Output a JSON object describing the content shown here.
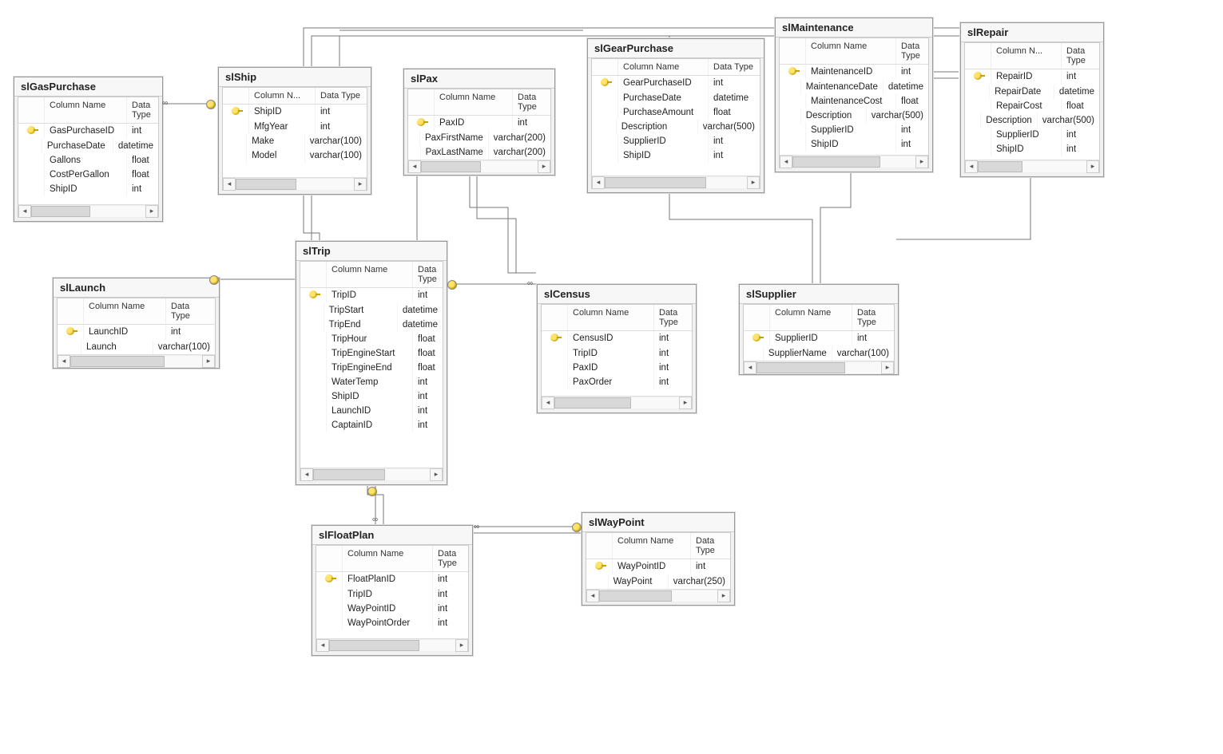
{
  "headers": {
    "col": "Column Name",
    "colShort": "Column N...",
    "type": "Data Type"
  },
  "tables": {
    "slGasPurchase": {
      "title": "slGasPurchase",
      "cols": [
        {
          "pk": true,
          "name": "GasPurchaseID",
          "type": "int"
        },
        {
          "pk": false,
          "name": "PurchaseDate",
          "type": "datetime"
        },
        {
          "pk": false,
          "name": "Gallons",
          "type": "float"
        },
        {
          "pk": false,
          "name": "CostPerGallon",
          "type": "float"
        },
        {
          "pk": false,
          "name": "ShipID",
          "type": "int"
        }
      ]
    },
    "slShip": {
      "title": "slShip",
      "cols": [
        {
          "pk": true,
          "name": "ShipID",
          "type": "int"
        },
        {
          "pk": false,
          "name": "MfgYear",
          "type": "int"
        },
        {
          "pk": false,
          "name": "Make",
          "type": "varchar(100)"
        },
        {
          "pk": false,
          "name": "Model",
          "type": "varchar(100)"
        }
      ]
    },
    "slPax": {
      "title": "slPax",
      "cols": [
        {
          "pk": true,
          "name": "PaxID",
          "type": "int"
        },
        {
          "pk": false,
          "name": "PaxFirstName",
          "type": "varchar(200)"
        },
        {
          "pk": false,
          "name": "PaxLastName",
          "type": "varchar(200)"
        }
      ]
    },
    "slGearPurchase": {
      "title": "slGearPurchase",
      "cols": [
        {
          "pk": true,
          "name": "GearPurchaseID",
          "type": "int"
        },
        {
          "pk": false,
          "name": "PurchaseDate",
          "type": "datetime"
        },
        {
          "pk": false,
          "name": "PurchaseAmount",
          "type": "float"
        },
        {
          "pk": false,
          "name": "Description",
          "type": "varchar(500)"
        },
        {
          "pk": false,
          "name": "SupplierID",
          "type": "int"
        },
        {
          "pk": false,
          "name": "ShipID",
          "type": "int"
        }
      ]
    },
    "slMaintenance": {
      "title": "slMaintenance",
      "cols": [
        {
          "pk": true,
          "name": "MaintenanceID",
          "type": "int"
        },
        {
          "pk": false,
          "name": "MaintenanceDate",
          "type": "datetime"
        },
        {
          "pk": false,
          "name": "MaintenanceCost",
          "type": "float"
        },
        {
          "pk": false,
          "name": "Description",
          "type": "varchar(500)"
        },
        {
          "pk": false,
          "name": "SupplierID",
          "type": "int"
        },
        {
          "pk": false,
          "name": "ShipID",
          "type": "int"
        }
      ]
    },
    "slRepair": {
      "title": "slRepair",
      "cols": [
        {
          "pk": true,
          "name": "RepairID",
          "type": "int"
        },
        {
          "pk": false,
          "name": "RepairDate",
          "type": "datetime"
        },
        {
          "pk": false,
          "name": "RepairCost",
          "type": "float"
        },
        {
          "pk": false,
          "name": "Description",
          "type": "varchar(500)"
        },
        {
          "pk": false,
          "name": "SupplierID",
          "type": "int"
        },
        {
          "pk": false,
          "name": "ShipID",
          "type": "int"
        }
      ]
    },
    "slLaunch": {
      "title": "slLaunch",
      "cols": [
        {
          "pk": true,
          "name": "LaunchID",
          "type": "int"
        },
        {
          "pk": false,
          "name": "Launch",
          "type": "varchar(100)"
        }
      ]
    },
    "slTrip": {
      "title": "slTrip",
      "cols": [
        {
          "pk": true,
          "name": "TripID",
          "type": "int"
        },
        {
          "pk": false,
          "name": "TripStart",
          "type": "datetime"
        },
        {
          "pk": false,
          "name": "TripEnd",
          "type": "datetime"
        },
        {
          "pk": false,
          "name": "TripHour",
          "type": "float"
        },
        {
          "pk": false,
          "name": "TripEngineStart",
          "type": "float"
        },
        {
          "pk": false,
          "name": "TripEngineEnd",
          "type": "float"
        },
        {
          "pk": false,
          "name": "WaterTemp",
          "type": "int"
        },
        {
          "pk": false,
          "name": "ShipID",
          "type": "int"
        },
        {
          "pk": false,
          "name": "LaunchID",
          "type": "int"
        },
        {
          "pk": false,
          "name": "CaptainID",
          "type": "int"
        }
      ]
    },
    "slCensus": {
      "title": "slCensus",
      "cols": [
        {
          "pk": true,
          "name": "CensusID",
          "type": "int"
        },
        {
          "pk": false,
          "name": "TripID",
          "type": "int"
        },
        {
          "pk": false,
          "name": "PaxID",
          "type": "int"
        },
        {
          "pk": false,
          "name": "PaxOrder",
          "type": "int"
        }
      ]
    },
    "slSupplier": {
      "title": "slSupplier",
      "cols": [
        {
          "pk": true,
          "name": "SupplierID",
          "type": "int"
        },
        {
          "pk": false,
          "name": "SupplierName",
          "type": "varchar(100)"
        }
      ]
    },
    "slFloatPlan": {
      "title": "slFloatPlan",
      "cols": [
        {
          "pk": true,
          "name": "FloatPlanID",
          "type": "int"
        },
        {
          "pk": false,
          "name": "TripID",
          "type": "int"
        },
        {
          "pk": false,
          "name": "WayPointID",
          "type": "int"
        },
        {
          "pk": false,
          "name": "WayPointOrder",
          "type": "int"
        }
      ]
    },
    "slWayPoint": {
      "title": "slWayPoint",
      "cols": [
        {
          "pk": true,
          "name": "WayPointID",
          "type": "int"
        },
        {
          "pk": false,
          "name": "WayPoint",
          "type": "varchar(250)"
        }
      ]
    }
  }
}
